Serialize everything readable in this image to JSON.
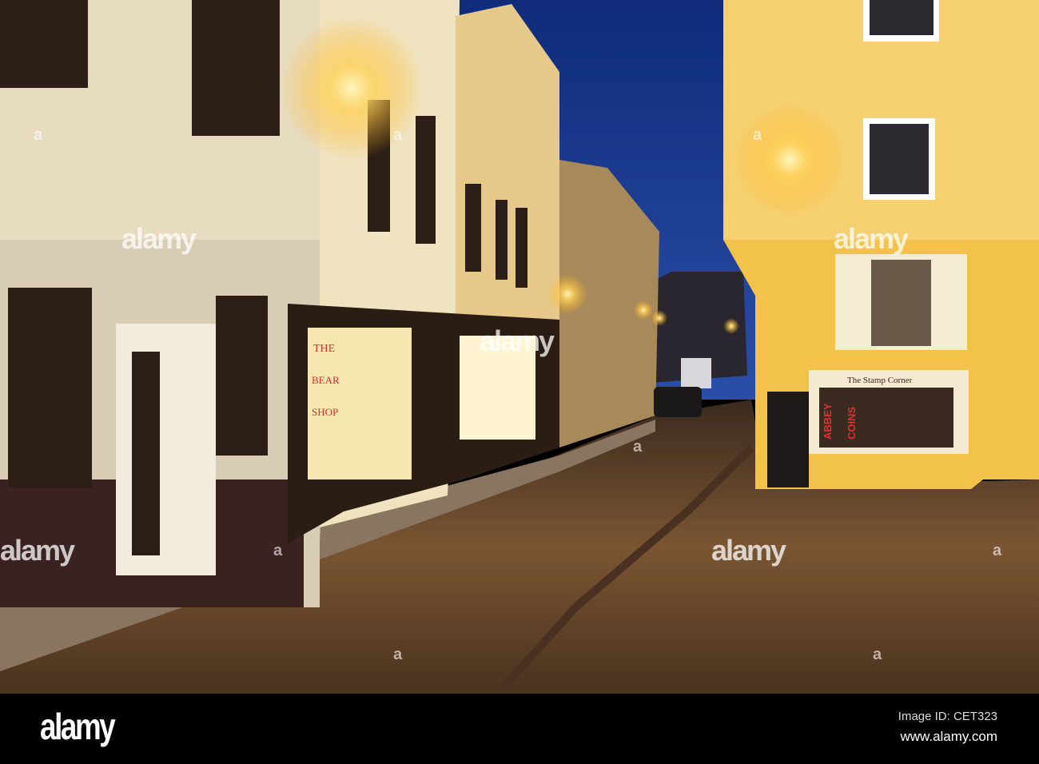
{
  "scene": {
    "shop_left_sign": [
      "THE",
      "BEAR",
      "SHOP"
    ],
    "shop_right_sign": "The Stamp Corner",
    "window_text_1": "ABBEY",
    "window_text_2": "COINS"
  },
  "watermark": {
    "brand": "alamy",
    "mark": "a"
  },
  "footer": {
    "logo": "alamy",
    "image_id": "Image ID: CET323",
    "url": "www.alamy.com"
  },
  "colors": {
    "sky": "#1b3a8c",
    "lamp": "#ffd25a",
    "cobble": "#6b4a2a",
    "wall_right": "#f2c24a"
  }
}
